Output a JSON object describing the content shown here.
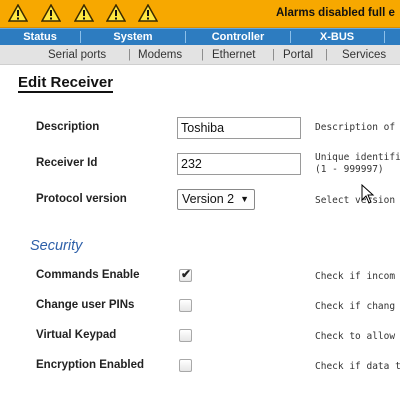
{
  "alarm": {
    "message": "Alarms disabled full e",
    "icons": [
      "warning-icon",
      "warning-icon",
      "warning-icon",
      "warning-icon",
      "warning-icon"
    ],
    "bar_color": "#f7a800"
  },
  "main_nav": {
    "items": [
      "Status",
      "System",
      "Controller",
      "X-BUS"
    ],
    "bar_color": "#2d7cc0"
  },
  "sub_nav": {
    "items": [
      "Serial ports",
      "Modems",
      "Ethernet",
      "Portal",
      "Services"
    ],
    "separator": "|"
  },
  "page": {
    "title": "Edit Receiver"
  },
  "form": {
    "description": {
      "label": "Description",
      "value": "Toshiba",
      "help": "Description of"
    },
    "receiver_id": {
      "label": "Receiver Id",
      "value": "232",
      "help_line1": "Unique identifi",
      "help_line2": "(1 - 999997)"
    },
    "protocol_version": {
      "label": "Protocol version",
      "value": "Version 2",
      "help": "Select version"
    }
  },
  "security": {
    "heading": "Security",
    "items": [
      {
        "label": "Commands Enable",
        "checked": true,
        "help": "Check if incom"
      },
      {
        "label": "Change user PINs",
        "checked": false,
        "help": "Check if chang"
      },
      {
        "label": "Virtual Keypad",
        "checked": false,
        "help": "Check to allow"
      },
      {
        "label": "Encryption Enabled",
        "checked": false,
        "help": "Check if data t"
      }
    ],
    "heading_color": "#2d5fa8"
  }
}
